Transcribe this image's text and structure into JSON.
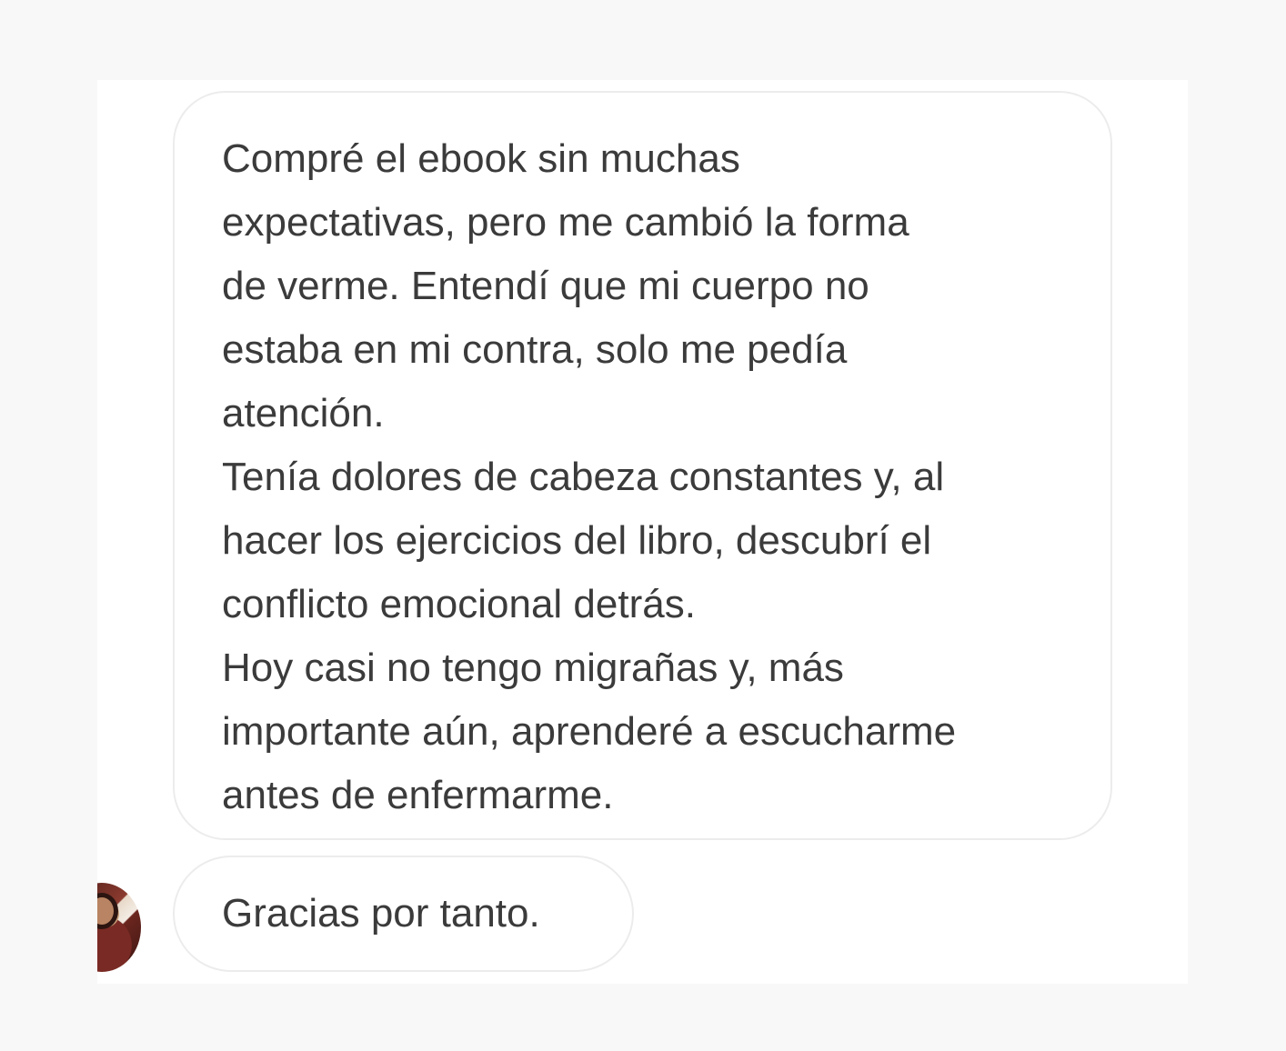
{
  "conversation": {
    "message_main": {
      "lines": [
        "Compré el ebook sin muchas",
        "expectativas, pero me cambió la forma",
        "de verme. Entendí que mi cuerpo no",
        "estaba en mi contra, solo me pedía",
        "atención.",
        "Tenía dolores de cabeza constantes y, al",
        "hacer los ejercicios del libro, descubrí el",
        "conflicto emocional detrás.",
        "Hoy casi no tengo migrañas y, más",
        "importante aún, aprenderé a escucharme",
        "antes de enfermarme."
      ]
    },
    "message_small": {
      "text": "Gracias por tanto."
    },
    "avatar_icon": "user-avatar-icon",
    "colors": {
      "page_background": "#f8f8f8",
      "card_background": "#ffffff",
      "bubble_border": "#ececec",
      "text": "#3b3b3b"
    }
  }
}
